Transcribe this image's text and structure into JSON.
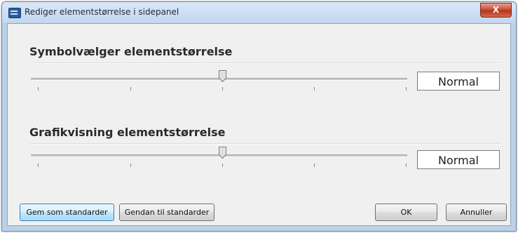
{
  "window": {
    "title": "Rediger elementstørrelse i sidepanel",
    "close_label": "X"
  },
  "sections": [
    {
      "title": "Symbolvælger elementstørrelse",
      "slider": {
        "position": 0.5,
        "ticks": 5
      },
      "value": "Normal"
    },
    {
      "title": "Grafikvisning elementstørrelse",
      "slider": {
        "position": 0.5,
        "ticks": 5
      },
      "value": "Normal"
    }
  ],
  "buttons": {
    "save_default": "Gem som standarder",
    "restore_default": "Gendan til standarder",
    "ok": "OK",
    "cancel": "Annuller"
  },
  "colors": {
    "title_bar": "#c7daf0",
    "close_button": "#c9442c",
    "dialog_bg": "#f0f0f0"
  }
}
